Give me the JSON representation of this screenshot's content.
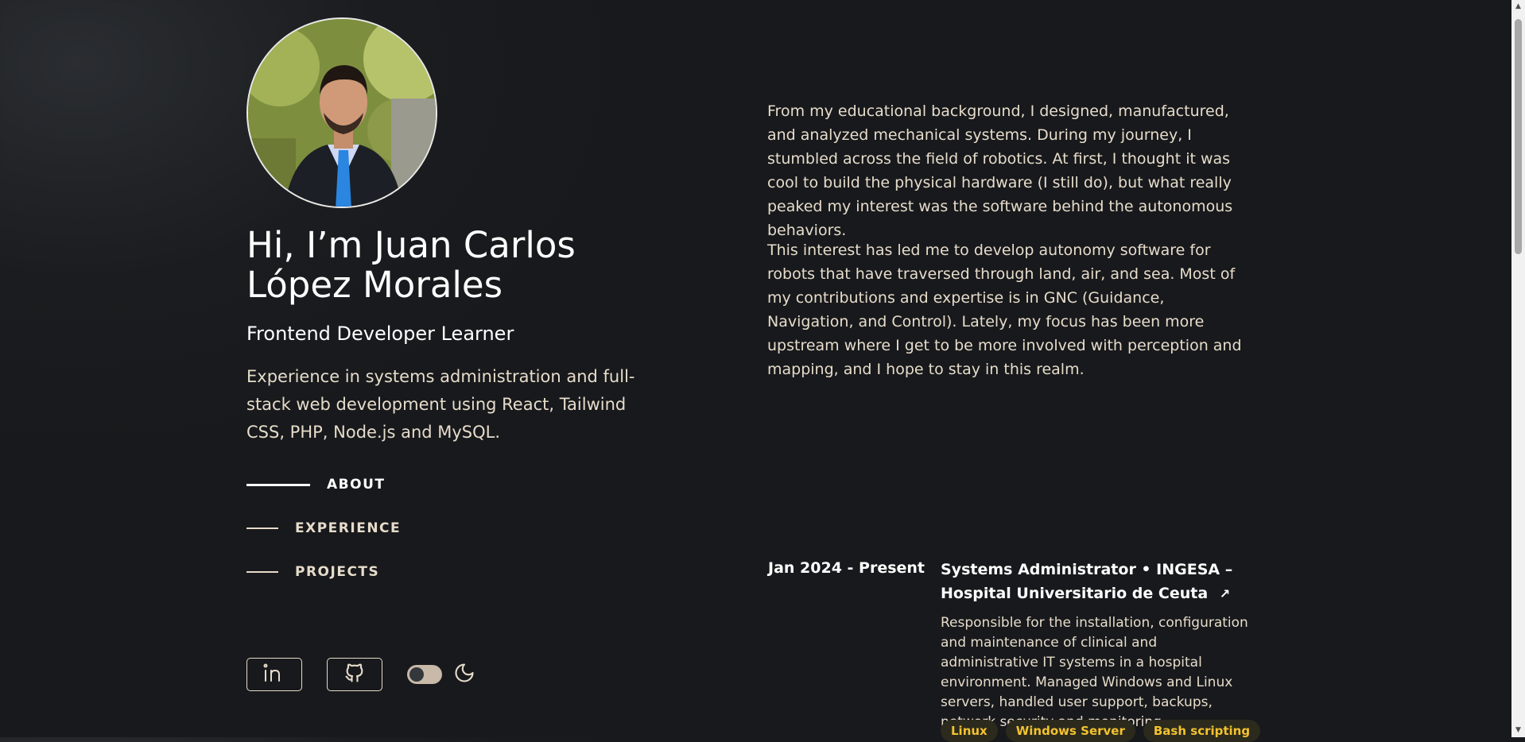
{
  "hero": {
    "name": "Hi, I’m Juan Carlos López Morales",
    "role": "Frontend Developer Learner",
    "intro": "Experience in systems administration and full-stack web development using React, Tailwind CSS, PHP, Node.js and MySQL."
  },
  "nav": {
    "items": [
      {
        "label": "ABOUT",
        "active": true
      },
      {
        "label": "EXPERIENCE",
        "active": false
      },
      {
        "label": "PROJECTS",
        "active": false
      }
    ]
  },
  "social": {
    "linkedin_icon": "linkedin-icon",
    "github_icon": "github-icon",
    "theme_toggle_icon": "moon-icon"
  },
  "about": {
    "paragraphs": [
      "From my educational background, I designed, manufactured, and analyzed mechanical systems. During my journey, I stumbled across the field of robotics. At first, I thought it was cool to build the physical hardware (I still do), but what really peaked my interest was the software behind the autonomous behaviors.",
      "This interest has led me to develop autonomy software for robots that have traversed through land, air, and sea. Most of my contributions and expertise is in GNC (Guidance, Navigation, and Control). Lately, my focus has been more upstream where I get to be more involved with perception and mapping, and I hope to stay in this realm."
    ]
  },
  "experience": {
    "items": [
      {
        "date": "Jan 2024 - Present",
        "title": "Systems Administrator • INGESA – Hospital Universitario de Ceuta",
        "arrow": "↗",
        "description": "Responsible for the installation, configuration and maintenance of clinical and administrative IT systems in a hospital environment. Managed Windows and Linux servers, handled user support, backups, network security and monitoring.",
        "tags": [
          "Linux",
          "Windows Server",
          "Bash scripting"
        ]
      }
    ]
  },
  "colors": {
    "background": "#18191c",
    "text": "#e6dccb",
    "heading": "#ffffff",
    "tag_text": "#f2c230",
    "tag_bg": "#2c2a1c"
  }
}
